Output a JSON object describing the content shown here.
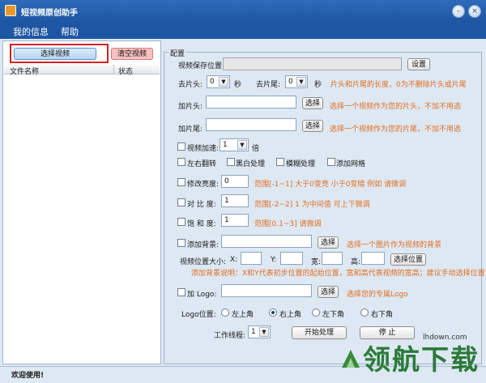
{
  "window": {
    "title": "短视频原创助手",
    "min_glyph": "–",
    "close_glyph": "×"
  },
  "menu": {
    "items": [
      "我的信息",
      "帮助"
    ]
  },
  "left": {
    "select_video": "选择视频",
    "clear_video": "清空视频",
    "col_filename": "文件名称",
    "col_status": "状态"
  },
  "config": {
    "title": "配置",
    "save_path_label": "视频保存位置:",
    "save_path_value": "",
    "settings_button": "设置",
    "cut_head_label": "去片头:",
    "cut_head_value": "0",
    "cut_tail_label": "去片尾:",
    "cut_tail_value": "0",
    "sec_unit": "秒",
    "cut_hint": "片头和片尾的长度，0为不删除片头或片尾",
    "add_head_label": "加片头:",
    "add_head_button": "选择",
    "add_head_hint": "选择一个视频作为您的片头，不加不用选",
    "add_tail_label": "加片尾:",
    "add_tail_button": "选择",
    "add_tail_hint": "选择一个视频作为您的片尾，不加不用选",
    "speed_label": "视频加速:",
    "speed_value": "1",
    "speed_unit": "倍",
    "flip_label": "左右翻转",
    "bw_label": "黑白处理",
    "blur_label": "模糊处理",
    "grid_label": "添加网格",
    "brightness_label": "修改亮度:",
    "brightness_value": "0",
    "brightness_hint": "范围[-1~1]  大于0变亮 小于0变暗  例如 请微调",
    "contrast_label": "对 比 度:",
    "contrast_value": "1",
    "contrast_hint": "范围[-2~2]  1 为中间值  可上下微调",
    "saturation_label": "饱 和 度:",
    "saturation_value": "1",
    "saturation_hint": "范围[0.1~3]  请微调",
    "bg_label": "添加背景:",
    "bg_button": "选择",
    "bg_hint": "选择一个图片作为视频的背景",
    "pos_size_label": "视频位置大小:",
    "x_label": "X:",
    "y_label": "Y:",
    "w_label": "宽:",
    "h_label": "高:",
    "pos_button": "选择位置",
    "bg_note": "添加背景说明：X和Y代表初步位置的起始位置，宽和高代表视频的宽高；建议手动选择位置",
    "logo_label": "加 Logo:",
    "logo_button": "选择",
    "logo_hint": "选择您的专属Logo",
    "logo_pos_label": "Logo位置:",
    "logo_positions": [
      "左上角",
      "右上角",
      "左下角",
      "右下角"
    ],
    "threads_label": "工作线程:",
    "threads_value": "1",
    "start_button": "开始处理",
    "stop_button": "停    止"
  },
  "status": {
    "text": "欢迎使用!"
  },
  "watermark": {
    "text": "领航下载",
    "url": "lhdown.com"
  }
}
